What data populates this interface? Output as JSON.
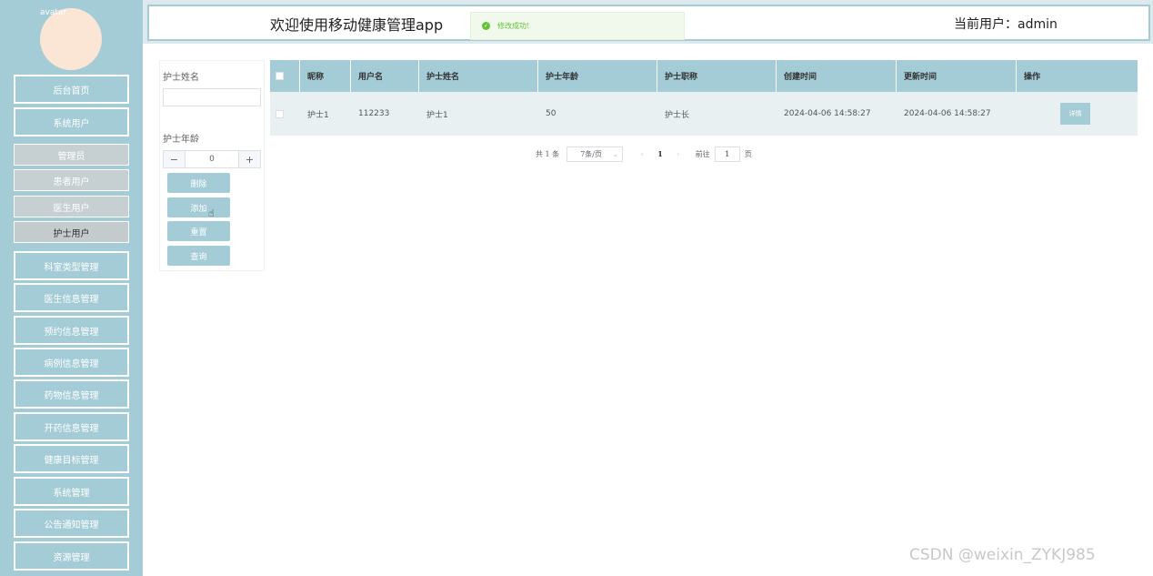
{
  "app": {
    "title": "欢迎使用移动健康管理app",
    "current_user": "当前用户：admin"
  },
  "avatar_alt": "avatar",
  "toast": {
    "message": "修改成功!",
    "color": "#67c23a"
  },
  "sidebar": {
    "items": [
      {
        "label": "后台首页"
      },
      {
        "label": "系统用户"
      }
    ],
    "sub_items": [
      {
        "label": "管理员"
      },
      {
        "label": "患者用户"
      },
      {
        "label": "医生用户"
      },
      {
        "label": "护士用户",
        "active": true
      }
    ],
    "more_items": [
      {
        "label": "科室类型管理"
      },
      {
        "label": "医生信息管理"
      },
      {
        "label": "预约信息管理"
      },
      {
        "label": "病例信息管理"
      },
      {
        "label": "药物信息管理"
      },
      {
        "label": "开药信息管理"
      },
      {
        "label": "健康目标管理"
      },
      {
        "label": "系统管理"
      },
      {
        "label": "公告通知管理"
      },
      {
        "label": "资源管理"
      }
    ]
  },
  "filter": {
    "name_label": "护士姓名",
    "name_value": "",
    "age_label": "护士年龄",
    "age_value": "0",
    "buttons": {
      "delete": "删除",
      "add": "添加",
      "reset": "重置",
      "search": "查询"
    }
  },
  "table": {
    "headers": [
      "昵称",
      "用户名",
      "护士姓名",
      "护士年龄",
      "护士职称",
      "创建时间",
      "更新时间",
      "操作"
    ],
    "rows": [
      {
        "nickname": "护士1",
        "username": "112233",
        "name": "护士1",
        "age": "50",
        "title": "护士长",
        "created": "2024-04-06 14:58:27",
        "updated": "2024-04-06 14:58:27",
        "action": "详情"
      }
    ]
  },
  "pagination": {
    "total": "共 1 条",
    "page_size": "7条/页",
    "current": "1",
    "goto_label": "前往",
    "goto_value": "1",
    "page_suffix": "页"
  },
  "watermark": "CSDN @weixin_ZYKJ985",
  "colors": {
    "accent": "#a4ccd6"
  }
}
